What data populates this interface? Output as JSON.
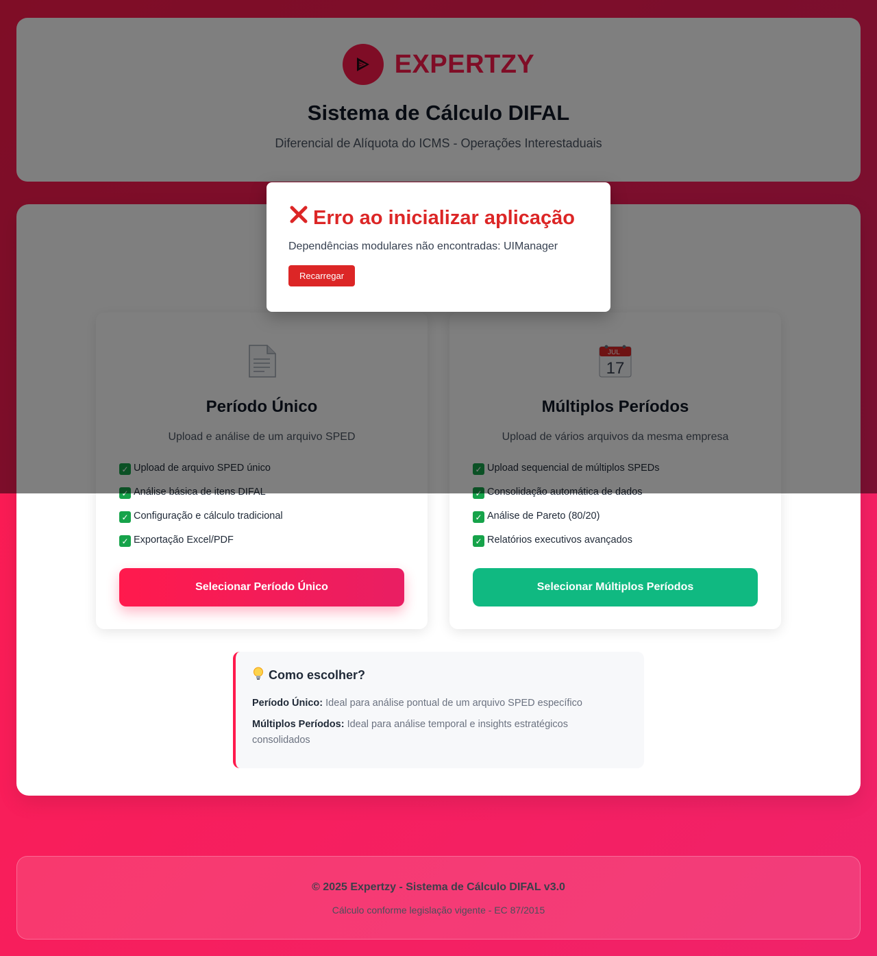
{
  "header": {
    "brand_name": "EXPERTZY",
    "title": "Sistema de Cálculo DIFAL",
    "subtitle": "Diferencial de Alíquota do ICMS - Operações Interestaduais"
  },
  "modes": [
    {
      "icon": "page-icon",
      "title": "Período Único",
      "description": "Upload e análise de um arquivo SPED",
      "features": [
        "Upload de arquivo SPED único",
        "Análise básica de itens DIFAL",
        "Configuração e cálculo tradicional",
        "Exportação Excel/PDF"
      ],
      "button_label": "Selecionar Período Único",
      "button_color": "#ff1a4d"
    },
    {
      "icon": "calendar-icon",
      "icon_month": "JUL",
      "icon_day": "17",
      "title": "Múltiplos Períodos",
      "description": "Upload de vários arquivos da mesma empresa",
      "features": [
        "Upload sequencial de múltiplos SPEDs",
        "Consolidação automática de dados",
        "Análise de Pareto (80/20)",
        "Relatórios executivos avançados"
      ],
      "button_label": "Selecionar Múltiplos Períodos",
      "button_color": "#10b981"
    }
  ],
  "help": {
    "title": "Como escolher?",
    "single_label": "Período Único:",
    "single_text": "Ideal para análise pontual de um arquivo SPED específico",
    "multi_label": "Múltiplos Períodos:",
    "multi_text": "Ideal para análise temporal e insights estratégicos consolidados"
  },
  "error_modal": {
    "title": "Erro ao inicializar aplicação",
    "message": "Dependências modulares não encontradas: UIManager",
    "button_label": "Recarregar",
    "color": "#dc2626"
  },
  "footer": {
    "copyright": "© 2025 Expertzy - Sistema de Cálculo DIFAL v3.0",
    "note": "Cálculo conforme legislação vigente - EC 87/2015"
  },
  "colors": {
    "brand": "#ff1a4d",
    "success": "#10b981"
  }
}
